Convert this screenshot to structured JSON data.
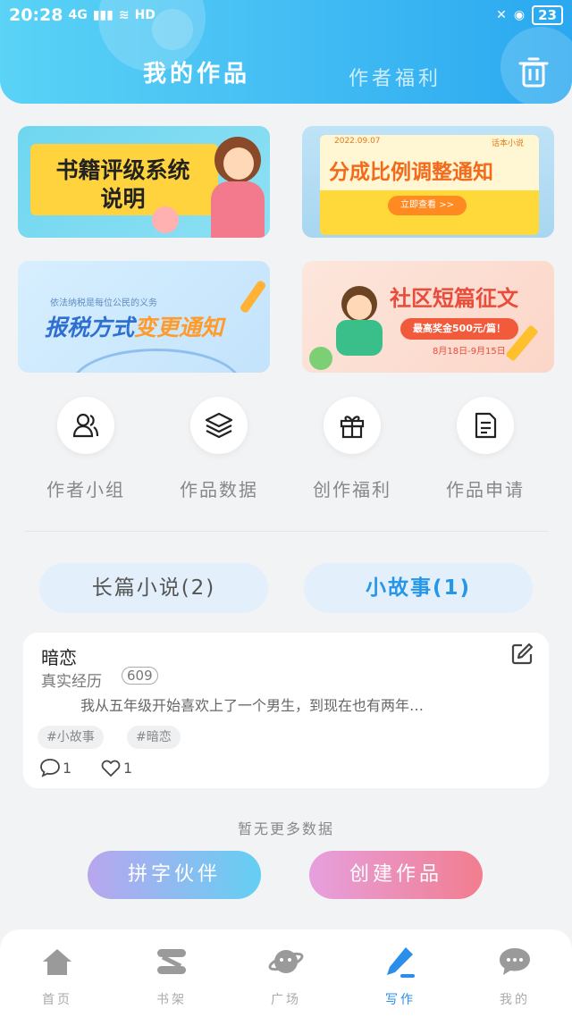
{
  "status_bar": {
    "time": "20:28",
    "signal_label": "4G",
    "hd_label": "HD",
    "battery": "23"
  },
  "header": {
    "tabs": [
      {
        "label": "我的作品",
        "active": true
      },
      {
        "label": "作者福利",
        "active": false
      }
    ],
    "accent_color": "#2aa8f0"
  },
  "banners": {
    "rating_system": {
      "line1": "书籍评级系统",
      "line2": "说明"
    },
    "revenue_share": {
      "date": "2022.09.07",
      "brand": "话本小说",
      "title": "分成比例调整通知",
      "button": "立即查看 >>"
    },
    "tax": {
      "subtitle": "依法纳税是每位公民的义务",
      "title_a": "报税方式",
      "title_b": "变更通知"
    },
    "contest": {
      "title": "社区短篇征文",
      "prize": "最高奖金500元/篇！",
      "dates": "8月18日-9月15日"
    }
  },
  "quick_actions": [
    {
      "label": "作者小组",
      "icon": "users-icon"
    },
    {
      "label": "作品数据",
      "icon": "layers-icon"
    },
    {
      "label": "创作福利",
      "icon": "gift-icon"
    },
    {
      "label": "作品申请",
      "icon": "document-icon"
    }
  ],
  "work_tabs": {
    "long": "长篇小说(2)",
    "short": "小故事(1)"
  },
  "work_card": {
    "title": "暗恋",
    "genre": "真实经历",
    "count": "609",
    "excerpt": "我从五年级开始喜欢上了一个男生，到现在也有两年…",
    "tags": [
      "#小故事",
      "#暗恋"
    ],
    "comments": "1",
    "likes": "1"
  },
  "no_more_text": "暂无更多数据",
  "buttons": {
    "partner": "拼字伙伴",
    "create": "创建作品"
  },
  "bottom_nav": [
    {
      "label": "首页",
      "icon": "home-icon"
    },
    {
      "label": "书架",
      "icon": "bookshelf-icon"
    },
    {
      "label": "广场",
      "icon": "planet-icon"
    },
    {
      "label": "写作",
      "icon": "pen-icon"
    },
    {
      "label": "我的",
      "icon": "chat-icon"
    }
  ]
}
